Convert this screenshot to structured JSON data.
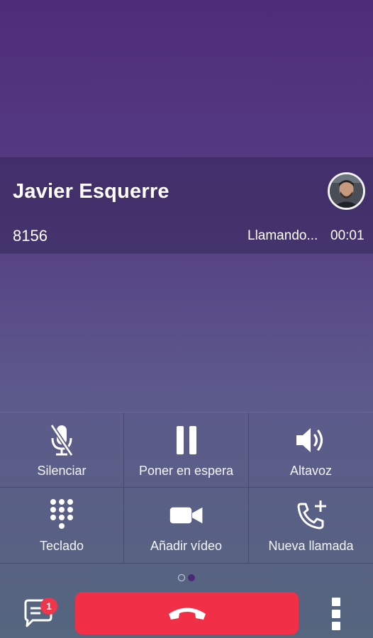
{
  "contact": {
    "name": "Javier Esquerre",
    "number": "8156",
    "status": "Llamando...",
    "timer": "00:01"
  },
  "controls": [
    {
      "label": "Silenciar",
      "icon": "mic-off-icon"
    },
    {
      "label": "Poner en espera",
      "icon": "pause-icon"
    },
    {
      "label": "Altavoz",
      "icon": "speaker-icon"
    },
    {
      "label": "Teclado",
      "icon": "dialpad-icon"
    },
    {
      "label": "Añadir vídeo",
      "icon": "video-camera-icon"
    },
    {
      "label": "Nueva llamada",
      "icon": "add-call-icon"
    }
  ],
  "pager": {
    "pages": 2,
    "current": 2
  },
  "bottom_bar": {
    "chat_badge": "1",
    "hangup_icon": "hangup-icon",
    "more_icon": "more-vertical-icon"
  },
  "colors": {
    "hangup": "#f12f47",
    "badge": "#f0364d",
    "background_top": "#4f2c7a",
    "background_bottom": "#55667e"
  }
}
